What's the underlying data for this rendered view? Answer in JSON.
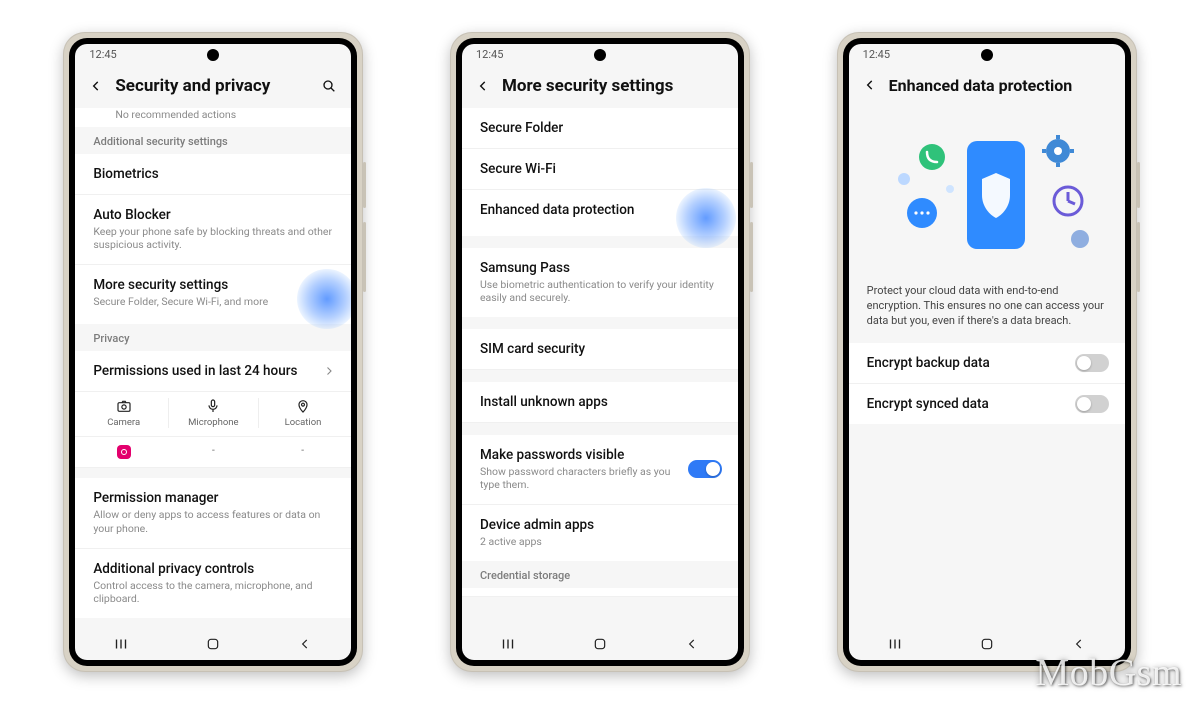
{
  "watermark": "MobGsm",
  "status_time": "12:45",
  "phone1": {
    "title": "Security and privacy",
    "hint": "No recommended actions",
    "sec_additional": "Additional security settings",
    "biometrics": "Biometrics",
    "autoblocker": {
      "label": "Auto Blocker",
      "sub": "Keep your phone safe by blocking threats and other suspicious activity."
    },
    "more": {
      "label": "More security settings",
      "sub": "Secure Folder, Secure Wi-Fi, and more"
    },
    "sec_privacy": "Privacy",
    "permissions_header": "Permissions used in last 24 hours",
    "perm_camera": "Camera",
    "perm_mic": "Microphone",
    "perm_loc": "Location",
    "dash2": "-",
    "dash3": "-",
    "perm_mgr": {
      "label": "Permission manager",
      "sub": "Allow or deny apps to access features or data on your phone."
    },
    "addl_priv": {
      "label": "Additional privacy controls",
      "sub": "Control access to the camera, microphone, and clipboard."
    }
  },
  "phone2": {
    "title": "More security settings",
    "secure_folder": "Secure Folder",
    "secure_wifi": "Secure Wi-Fi",
    "enhanced": "Enhanced data protection",
    "pass": {
      "label": "Samsung Pass",
      "sub": "Use biometric authentication to verify your identity easily and securely."
    },
    "sim": "SIM card security",
    "install": "Install unknown apps",
    "pwvisible": {
      "label": "Make passwords visible",
      "sub": "Show password characters briefly as you type them."
    },
    "admin": {
      "label": "Device admin apps",
      "sub": "2 active apps"
    },
    "cred": "Credential storage"
  },
  "phone3": {
    "title": "Enhanced data protection",
    "desc": "Protect your cloud data with end-to-end encryption. This ensures no one can access your data but you, even if there's a data breach.",
    "encrypt_backup": "Encrypt backup data",
    "encrypt_synced": "Encrypt synced data"
  }
}
